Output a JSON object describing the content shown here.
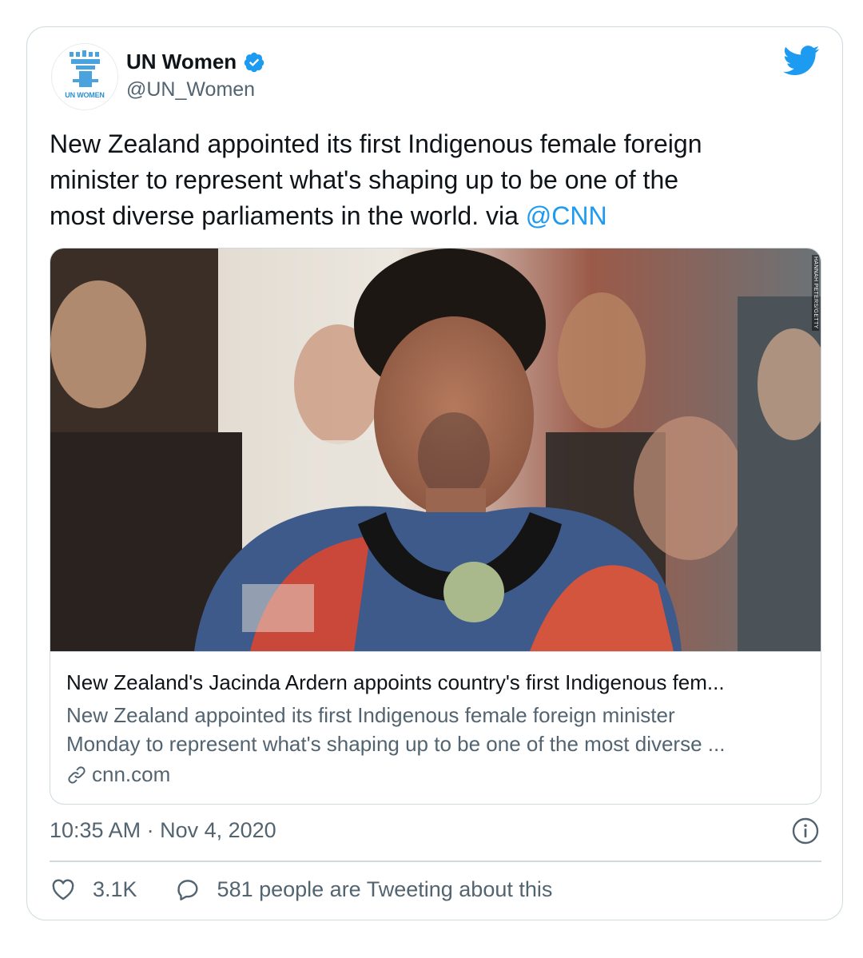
{
  "tweet": {
    "author": {
      "display_name": "UN Women",
      "handle": "@UN_Women",
      "avatar_text": "UN WOMEN",
      "verified": true
    },
    "text_parts": {
      "line1": "New Zealand appointed its first Indigenous female foreign",
      "line2": "minister to represent what's shaping up to be one of the",
      "line3": "most diverse parliaments in the world. via ",
      "mention": "@CNN"
    },
    "card": {
      "image_credit": "HANNAH PETERS/GETTY",
      "title": "New Zealand's Jacinda Ardern appoints country's first Indigenous fem...",
      "description_line1": "New Zealand appointed its first Indigenous female foreign minister",
      "description_line2": "Monday to represent what's shaping up to be one of the most diverse ...",
      "domain": "cnn.com"
    },
    "timestamp": "10:35 AM · Nov 4, 2020",
    "actions": {
      "likes": "3.1K",
      "tweeting_about": "581 people are Tweeting about this"
    }
  },
  "colors": {
    "link_blue": "#1d9bf0",
    "secondary_text": "#536471",
    "border": "#cfd9de"
  },
  "icons": [
    "un-women-logo-icon",
    "verified-badge-icon",
    "twitter-bird-icon",
    "link-icon",
    "info-icon",
    "heart-icon",
    "reply-icon"
  ]
}
